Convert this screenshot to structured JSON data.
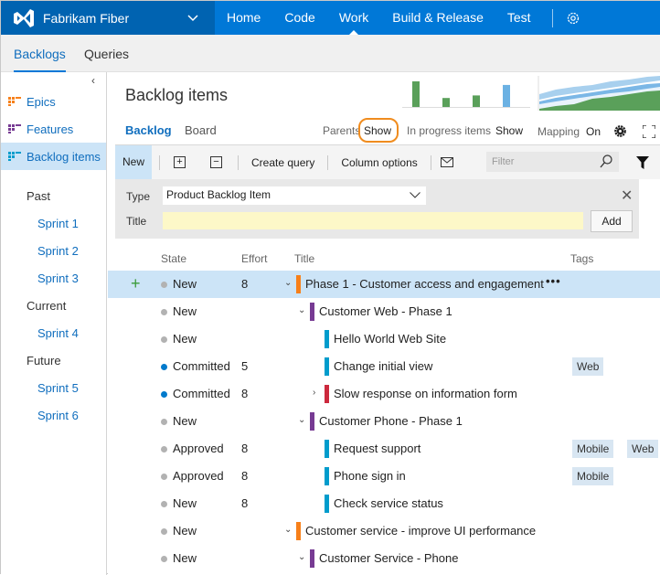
{
  "app": {
    "project_name": "Fabrikam Fiber",
    "nav": [
      "Home",
      "Code",
      "Work",
      "Build & Release",
      "Test"
    ],
    "active_nav": "Work"
  },
  "subnav": {
    "tabs": [
      "Backlogs",
      "Queries"
    ],
    "active": "Backlogs"
  },
  "sidebar": {
    "backlogs": [
      {
        "label": "Epics",
        "color": "#f7801a"
      },
      {
        "label": "Features",
        "color": "#773b93"
      },
      {
        "label": "Backlog items",
        "color": "#009ccc"
      }
    ],
    "active": "Backlog items",
    "groups": [
      {
        "label": "Past",
        "sprints": [
          "Sprint 1",
          "Sprint 2",
          "Sprint 3"
        ]
      },
      {
        "label": "Current",
        "sprints": [
          "Sprint 4"
        ]
      },
      {
        "label": "Future",
        "sprints": [
          "Sprint 5",
          "Sprint 6"
        ]
      }
    ]
  },
  "header": {
    "title": "Backlog items",
    "pivots": [
      "Backlog",
      "Board"
    ],
    "active_pivot": "Backlog",
    "parents_label": "Parents",
    "parents_value": "Show",
    "in_progress_label": "In progress items",
    "in_progress_value": "Show",
    "mapping_label": "Mapping",
    "mapping_value": "On"
  },
  "minicharts": {
    "velocity_bars": [
      {
        "value": 1.0,
        "color": "#5aa05a"
      },
      {
        "value": 0.35,
        "color": "#5aa05a"
      },
      {
        "value": 0.45,
        "color": "#5aa05a"
      },
      {
        "value": 0.86,
        "color": "#6bb1e3"
      }
    ]
  },
  "toolbar": {
    "new_label": "New",
    "expand_label": "+",
    "collapse_label": "−",
    "create_query": "Create query",
    "column_options": "Column options",
    "filter_placeholder": "Filter"
  },
  "add_panel": {
    "type_label": "Type",
    "type_value": "Product Backlog Item",
    "title_label": "Title",
    "title_value": "",
    "add_button": "Add",
    "close": "✕"
  },
  "columns": [
    "State",
    "Effort",
    "Title",
    "Tags"
  ],
  "rows": [
    {
      "state": "New",
      "state_color": "#b2b2b2",
      "effort": "8",
      "title": "Phase 1 - Customer access and engagement",
      "level": 0,
      "toggle": "⌄",
      "bar": "#f7801a",
      "tags": [],
      "selected": true
    },
    {
      "state": "New",
      "state_color": "#b2b2b2",
      "effort": "",
      "title": "Customer Web - Phase 1",
      "level": 1,
      "toggle": "⌄",
      "bar": "#773b93",
      "tags": []
    },
    {
      "state": "New",
      "state_color": "#b2b2b2",
      "effort": "",
      "title": "Hello World Web Site",
      "level": 2,
      "toggle": "",
      "bar": "#009ccc",
      "tags": []
    },
    {
      "state": "Committed",
      "state_color": "#007acc",
      "effort": "5",
      "title": "Change initial view",
      "level": 2,
      "toggle": "",
      "bar": "#009ccc",
      "tags": [
        "Web"
      ]
    },
    {
      "state": "Committed",
      "state_color": "#007acc",
      "effort": "8",
      "title": "Slow response on information form",
      "level": 2,
      "toggle": "›",
      "bar": "#cc293d",
      "tags": []
    },
    {
      "state": "New",
      "state_color": "#b2b2b2",
      "effort": "",
      "title": "Customer Phone - Phase 1",
      "level": 1,
      "toggle": "⌄",
      "bar": "#773b93",
      "tags": []
    },
    {
      "state": "Approved",
      "state_color": "#b2b2b2",
      "effort": "8",
      "title": "Request support",
      "level": 2,
      "toggle": "",
      "bar": "#009ccc",
      "tags": [
        "Mobile",
        "Web"
      ]
    },
    {
      "state": "Approved",
      "state_color": "#b2b2b2",
      "effort": "8",
      "title": "Phone sign in",
      "level": 2,
      "toggle": "",
      "bar": "#009ccc",
      "tags": [
        "Mobile"
      ]
    },
    {
      "state": "New",
      "state_color": "#b2b2b2",
      "effort": "8",
      "title": "Check service status",
      "level": 2,
      "toggle": "",
      "bar": "#009ccc",
      "tags": []
    },
    {
      "state": "New",
      "state_color": "#b2b2b2",
      "effort": "",
      "title": "Customer service - improve UI performance",
      "level": 0,
      "toggle": "⌄",
      "bar": "#f7801a",
      "tags": []
    },
    {
      "state": "New",
      "state_color": "#b2b2b2",
      "effort": "",
      "title": "Customer Service - Phone",
      "level": 1,
      "toggle": "⌄",
      "bar": "#773b93",
      "tags": []
    }
  ],
  "row_actions": {
    "add_child": "+",
    "more": "•••"
  }
}
